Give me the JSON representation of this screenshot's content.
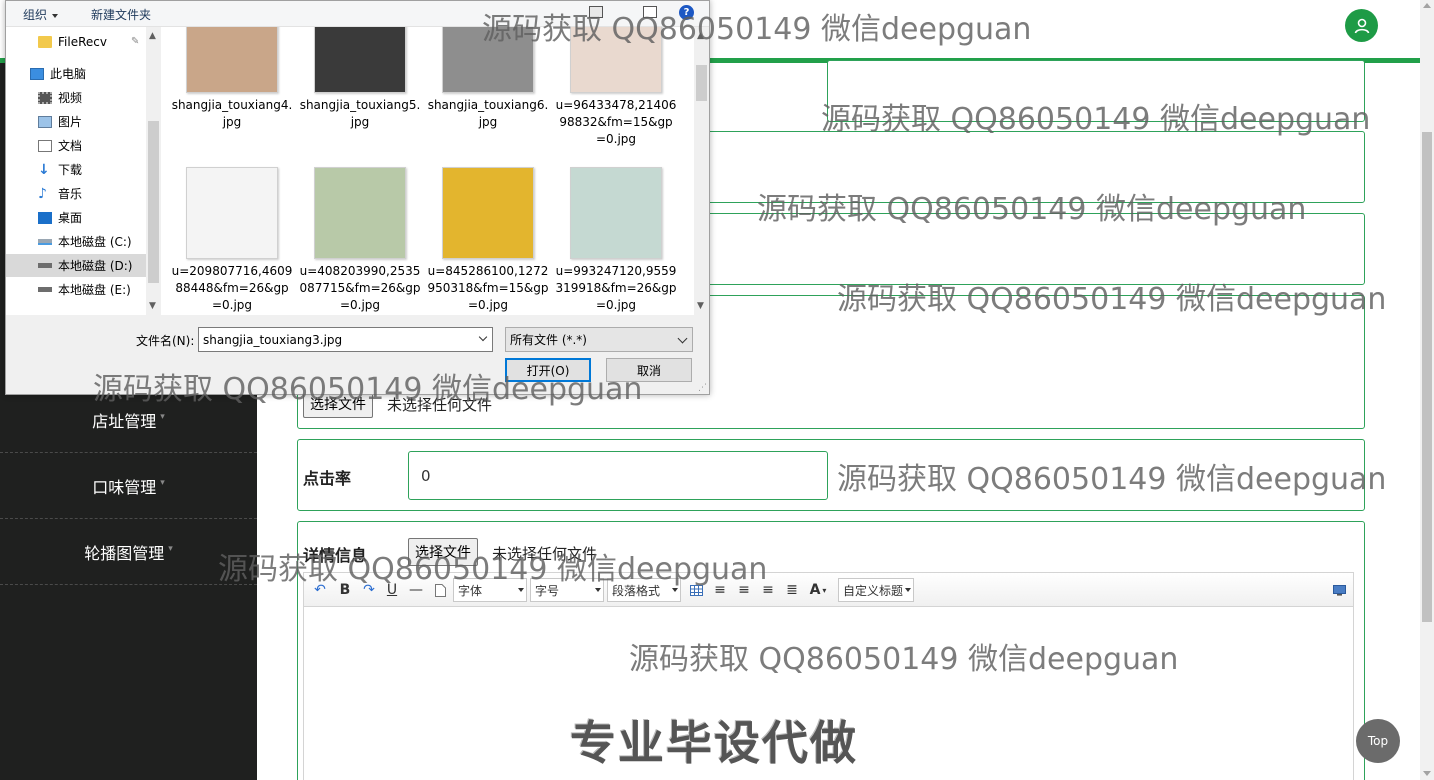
{
  "sidebar": {
    "items": [
      {
        "label": "店址管理"
      },
      {
        "label": "口味管理"
      },
      {
        "label": "轮播图管理"
      }
    ]
  },
  "form": {
    "file_button": "选择文件",
    "no_file": "未选择任何文件",
    "click_rate": {
      "label": "点击率",
      "value": "0"
    },
    "detail": {
      "label": "详情信息",
      "file_button": "选择文件",
      "no_file": "未选择任何文件"
    }
  },
  "editor": {
    "toolbar": {
      "bold": "B",
      "underline": "U",
      "font": "字体",
      "size": "字号",
      "paragraph": "段落格式",
      "font_color": "A",
      "custom_heading": "自定义标题"
    },
    "body_text": "专业毕设代做"
  },
  "top_button": "Top",
  "dialog": {
    "toolbar": {
      "organize": "组织",
      "new_folder": "新建文件夹"
    },
    "nav": [
      {
        "label": "FileRecv",
        "icon": "folder-icon"
      },
      {
        "label": "此电脑",
        "icon": "computer-icon"
      },
      {
        "label": "视频",
        "icon": "video-icon"
      },
      {
        "label": "图片",
        "icon": "picture-icon"
      },
      {
        "label": "文档",
        "icon": "document-icon"
      },
      {
        "label": "下载",
        "icon": "download-icon"
      },
      {
        "label": "音乐",
        "icon": "music-icon"
      },
      {
        "label": "桌面",
        "icon": "desktop-icon"
      },
      {
        "label": "本地磁盘 (C:)",
        "icon": "drive-icon"
      },
      {
        "label": "本地磁盘 (D:)",
        "icon": "drive-icon"
      },
      {
        "label": "本地磁盘 (E:)",
        "icon": "drive-icon"
      }
    ],
    "files": [
      {
        "name": "shangjia_touxiang4.jpg",
        "color": "#c9a689"
      },
      {
        "name": "shangjia_touxiang5.jpg",
        "color": "#3a3a3a"
      },
      {
        "name": "shangjia_touxiang6.jpg",
        "color": "#8e8e8e"
      },
      {
        "name": "u=96433478,2140698832&fm=15&gp=0.jpg",
        "color": "#e9d9cf"
      },
      {
        "name": "u=209807716,460988448&fm=26&gp=0.jpg",
        "color": "#f4f4f4"
      },
      {
        "name": "u=408203990,2535087715&fm=26&gp=0.jpg",
        "color": "#b8c9a8"
      },
      {
        "name": "u=845286100,1272950318&fm=15&gp=0.jpg",
        "color": "#e3b52e"
      },
      {
        "name": "u=993247120,9559319918&fm=26&gp=0.jpg",
        "color": "#c5d9d2"
      }
    ],
    "filename_label": "文件名(N):",
    "filename_value": "shangjia_touxiang3.jpg",
    "filter": "所有文件 (*.*)",
    "open_button": "打开(O)",
    "cancel_button": "取消"
  },
  "watermarks": [
    "源码获取 QQ86050149 微信deepguan",
    "源码获取 QQ86050149 微信deepguan",
    "源码获取 QQ86050149 微信deepguan",
    "源码获取 QQ86050149 微信deepguan",
    "源码获取 QQ86050149 微信deepguan",
    "源码获取 QQ86050149 微信deepguan",
    "源码获取 QQ86050149 微信deepguan",
    "源码获取 QQ86050149 微信deepguan"
  ],
  "colors": {
    "accent": "#22a04a",
    "sidebar_bg": "#1f201f",
    "dialog_primary": "#0078d7"
  }
}
